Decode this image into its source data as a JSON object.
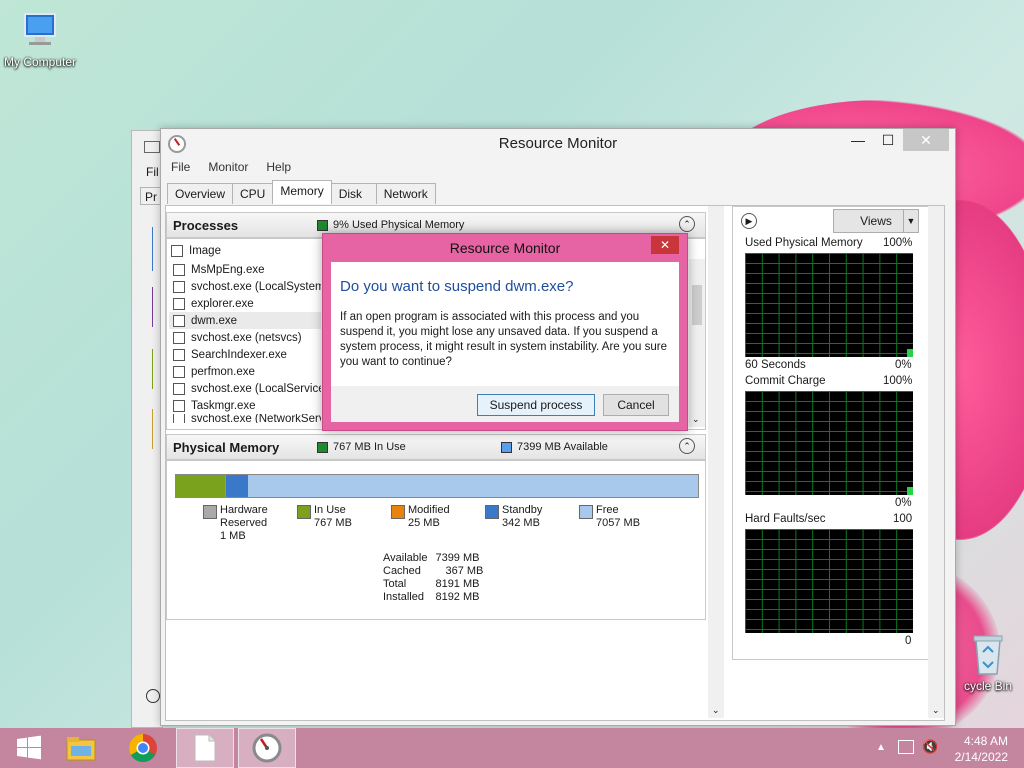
{
  "desktop": {
    "icons": [
      {
        "label": "My Computer"
      },
      {
        "label": "cycle Bin"
      }
    ]
  },
  "background_window": {
    "fragments": [
      "Fil",
      "Pr"
    ]
  },
  "resource_monitor": {
    "title": "Resource Monitor",
    "menu": [
      "File",
      "Monitor",
      "Help"
    ],
    "tabs": [
      "Overview",
      "CPU",
      "Memory",
      "Disk",
      "Network"
    ],
    "active_tab": "Memory",
    "processes": {
      "title": "Processes",
      "status": "9% Used Physical Memory",
      "header": "Image",
      "rows": [
        "MsMpEng.exe",
        "svchost.exe (LocalSystemN",
        "explorer.exe",
        "dwm.exe",
        "svchost.exe (netsvcs)",
        "SearchIndexer.exe",
        "perfmon.exe",
        "svchost.exe (LocalServiceN",
        "Taskmgr.exe",
        "svchost.exe (NetworkServi"
      ]
    },
    "physical_memory": {
      "title": "Physical Memory",
      "in_use_label": "767 MB In Use",
      "available_label": "7399 MB Available",
      "bar_fractions": {
        "hardware_reserved": 0.0001,
        "in_use": 0.0936,
        "modified": 0.003,
        "standby": 0.0417,
        "free": 0.8612
      },
      "legend": [
        {
          "name": "Hardware\nReserved",
          "value": "1 MB",
          "color": "#a9a9a9"
        },
        {
          "name": "In Use",
          "value": "767 MB",
          "color": "#7aa21c"
        },
        {
          "name": "Modified",
          "value": "25 MB",
          "color": "#e8820c"
        },
        {
          "name": "Standby",
          "value": "342 MB",
          "color": "#3a78c9"
        },
        {
          "name": "Free",
          "value": "7057 MB",
          "color": "#a8c8ec"
        }
      ],
      "stats": [
        {
          "label": "Available",
          "value": "7399 MB"
        },
        {
          "label": "Cached",
          "value": "367 MB"
        },
        {
          "label": "Total",
          "value": "8191 MB"
        },
        {
          "label": "Installed",
          "value": "8192 MB"
        }
      ]
    },
    "graphs": {
      "views_label": "Views",
      "used_physical": {
        "title": "Used Physical Memory",
        "max": "100%",
        "min": "0%",
        "time": "60 Seconds"
      },
      "commit_charge": {
        "title": "Commit Charge",
        "max": "100%",
        "min": "0%"
      },
      "hard_faults": {
        "title": "Hard Faults/sec",
        "max": "100",
        "min": "0"
      }
    }
  },
  "dialog": {
    "title": "Resource Monitor",
    "question": "Do you want to suspend dwm.exe?",
    "message": "If an open program is associated with this process and you suspend it, you might lose any unsaved data. If you suspend a system process, it might result in system instability. Are you sure you want to continue?",
    "suspend_label": "Suspend process",
    "cancel_label": "Cancel"
  },
  "taskbar": {
    "time": "4:48 AM",
    "date": "2/14/2022"
  },
  "colors": {
    "taskbar": "#c4859f",
    "dialog_frame": "#e664a4",
    "accent_blue": "#1f4e9a"
  }
}
